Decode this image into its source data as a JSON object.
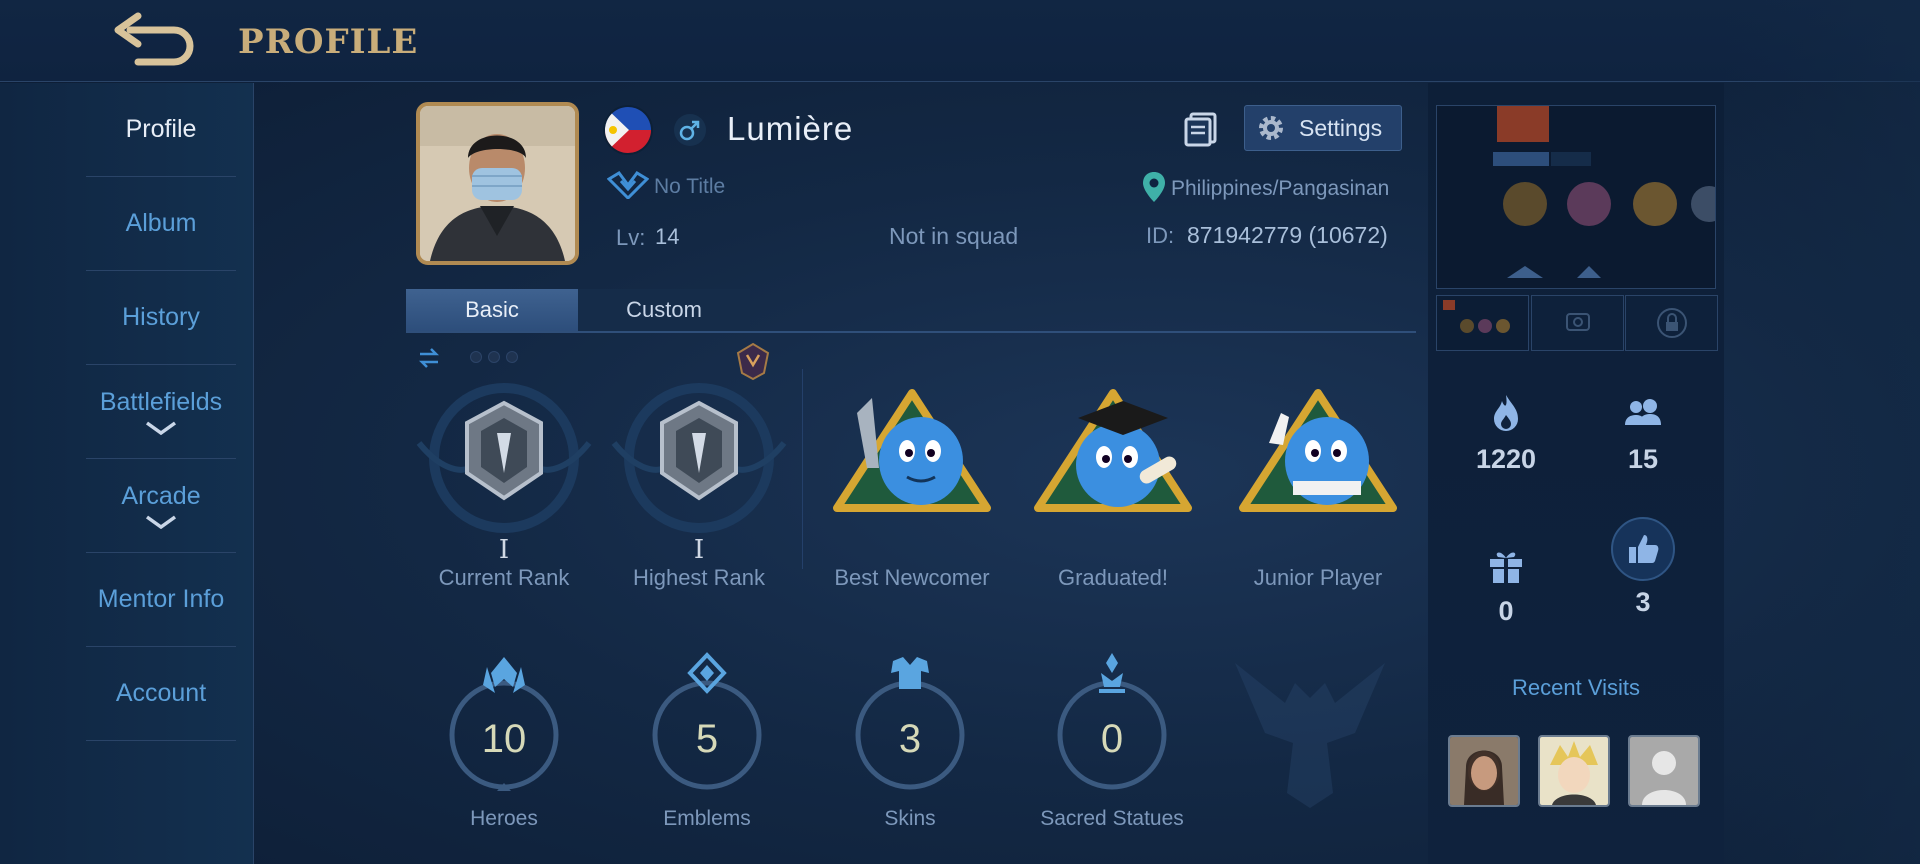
{
  "header": {
    "title": "PROFILE",
    "back_icon": "back-arrow-icon"
  },
  "sidebar": {
    "items": [
      {
        "label": "Profile",
        "active": true,
        "expandable": false
      },
      {
        "label": "Album",
        "active": false,
        "expandable": false
      },
      {
        "label": "History",
        "active": false,
        "expandable": false
      },
      {
        "label": "Battlefields",
        "active": false,
        "expandable": true
      },
      {
        "label": "Arcade",
        "active": false,
        "expandable": true
      },
      {
        "label": "Mentor Info",
        "active": false,
        "expandable": false
      },
      {
        "label": "Account",
        "active": false,
        "expandable": false
      }
    ]
  },
  "player": {
    "name": "Lumière",
    "gender": "male",
    "title": "No Title",
    "level_label": "Lv:",
    "level": "14",
    "squad": "Not in squad",
    "location": "Philippines/Pangasinan",
    "id_label": "ID:",
    "id": "871942779 (10672)",
    "flag": "philippines-flag"
  },
  "actions": {
    "settings_label": "Settings"
  },
  "tabs": [
    {
      "label": "Basic",
      "active": true
    },
    {
      "label": "Custom",
      "active": false
    }
  ],
  "ranks": [
    {
      "label": "Current Rank",
      "tier": "I"
    },
    {
      "label": "Highest Rank",
      "tier": "I"
    }
  ],
  "achievements": [
    {
      "label": "Best Newcomer"
    },
    {
      "label": "Graduated!"
    },
    {
      "label": "Junior Player"
    }
  ],
  "stats": [
    {
      "label": "Heroes",
      "value": "10",
      "icon": "heroes-icon"
    },
    {
      "label": "Emblems",
      "value": "5",
      "icon": "emblem-icon"
    },
    {
      "label": "Skins",
      "value": "3",
      "icon": "skins-icon"
    },
    {
      "label": "Sacred Statues",
      "value": "0",
      "icon": "statue-icon"
    }
  ],
  "right_panel": {
    "popularity": "1220",
    "followers": "15",
    "gifts": "0",
    "likes": "3",
    "recent_title": "Recent Visits"
  },
  "colors": {
    "accent_gold": "#c9ad7a",
    "link_blue": "#5b9fd9",
    "panel_bg": "#132844"
  }
}
